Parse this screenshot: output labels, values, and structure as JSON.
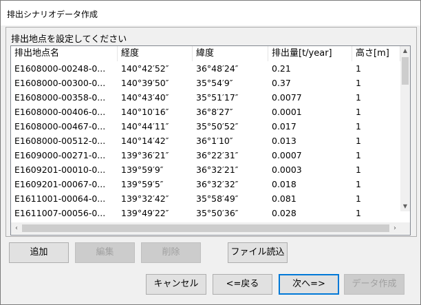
{
  "window": {
    "title": "排出シナリオデータ作成"
  },
  "group": {
    "label": "排出地点を設定してください"
  },
  "table": {
    "columns": [
      "排出地点名",
      "経度",
      "緯度",
      "排出量[t/year]",
      "高さ[m]"
    ],
    "rows": [
      [
        "E1608000-00248-0...",
        "140°42′52″",
        "36°48′24″",
        "0.21",
        "1"
      ],
      [
        "E1608000-00300-0...",
        "140°39′50″",
        "35°54′9″",
        "0.37",
        "1"
      ],
      [
        "E1608000-00358-0...",
        "140°43′40″",
        "35°51′17″",
        "0.0077",
        "1"
      ],
      [
        "E1608000-00406-0...",
        "140°10′16″",
        "36°8′27″",
        "0.0001",
        "1"
      ],
      [
        "E1608000-00467-0...",
        "140°44′11″",
        "35°50′52″",
        "0.017",
        "1"
      ],
      [
        "E1608000-00512-0...",
        "140°14′42″",
        "36°1′10″",
        "0.013",
        "1"
      ],
      [
        "E1609000-00271-0...",
        "139°36′21″",
        "36°22′31″",
        "0.0007",
        "1"
      ],
      [
        "E1609201-00010-0...",
        "139°59′9″",
        "36°32′21″",
        "0.0003",
        "1"
      ],
      [
        "E1609201-00067-0...",
        "139°59′5″",
        "36°32′32″",
        "0.018",
        "1"
      ],
      [
        "E1611001-00064-0...",
        "139°32′42″",
        "35°58′49″",
        "0.081",
        "1"
      ],
      [
        "E1611007-00056-0...",
        "139°49′22″",
        "35°50′36″",
        "0.028",
        "1"
      ]
    ]
  },
  "buttons": {
    "add": "追加",
    "edit": "編集",
    "delete": "削除",
    "file_load": "ファイル読込",
    "cancel": "キャンセル",
    "back": "<=戻る",
    "next": "次へ=>",
    "create": "データ作成"
  },
  "icons": {
    "scroll_up": "up-arrow-icon",
    "scroll_down": "down-arrow-icon",
    "scroll_left": "left-arrow-icon",
    "scroll_right": "right-arrow-icon"
  }
}
